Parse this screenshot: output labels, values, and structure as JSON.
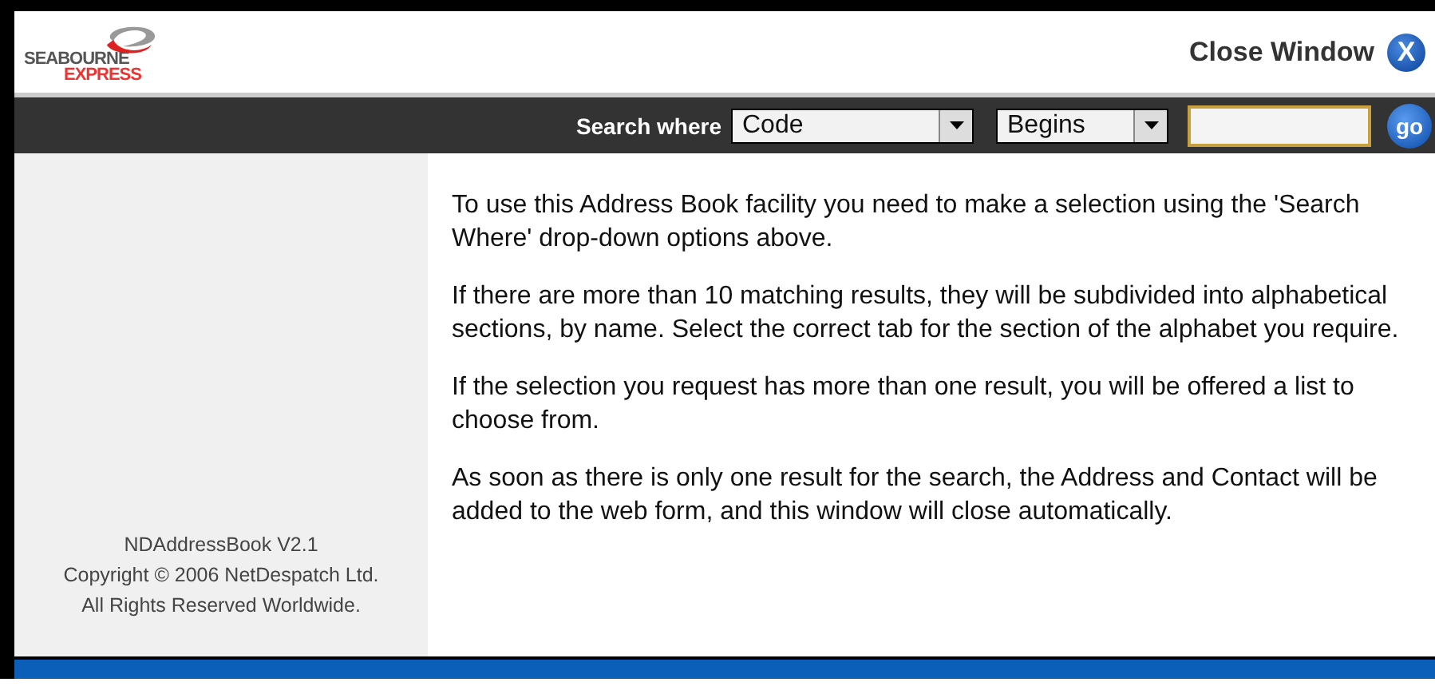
{
  "logo": {
    "line_1": "SEABOURNE",
    "line_2": "EXPRESS"
  },
  "close_link": {
    "label": "Close Window",
    "icon_text": "X"
  },
  "search": {
    "label": "Search where",
    "field_select": {
      "value": "Code"
    },
    "match_select": {
      "value": "Begins"
    },
    "go_button": {
      "label": "go"
    }
  },
  "instructions": [
    "To use this Address Book facility you need to make a selection using the 'Search Where' drop-down options above.",
    "If there are more than 10 matching results, they will be subdivided into alphabetical sections, by name.  Select the correct tab for the section of the alphabet you require.",
    "If the selection you request has more than one result, you will be offered a list to choose from.",
    "As soon as there is only one result for the search, the Address and Contact will be added to the web form, and this window will close automatically."
  ],
  "sidebar_footer": [
    "NDAddressBook V2.1",
    "Copyright © 2006 NetDespatch Ltd.",
    "All Rights Reserved Worldwide."
  ]
}
